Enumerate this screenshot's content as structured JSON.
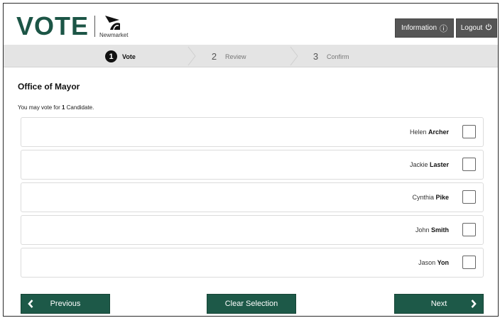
{
  "header": {
    "logo_text": "VOTE",
    "logo_subtext": "Newmarket",
    "info_label": "Information",
    "logout_label": "Logout"
  },
  "steps": [
    {
      "number": "1",
      "label": "Vote",
      "active": true
    },
    {
      "number": "2",
      "label": "Review",
      "active": false
    },
    {
      "number": "3",
      "label": "Confirm",
      "active": false
    }
  ],
  "ballot": {
    "office_title": "Office of Mayor",
    "instruction_prefix": "You may vote for ",
    "instruction_count": "1",
    "instruction_suffix": " Candidate.",
    "candidates": [
      {
        "first": "Helen",
        "last": "Archer",
        "selected": false
      },
      {
        "first": "Jackie",
        "last": "Laster",
        "selected": false
      },
      {
        "first": "Cynthia",
        "last": "Pike",
        "selected": false
      },
      {
        "first": "John",
        "last": "Smith",
        "selected": false
      },
      {
        "first": "Jason",
        "last": "Yon",
        "selected": false
      }
    ]
  },
  "footer": {
    "previous_label": "Previous",
    "clear_label": "Clear Selection",
    "next_label": "Next"
  },
  "colors": {
    "brand_green": "#1d5948",
    "header_button": "#555555",
    "steps_bar": "#e4e4e4"
  },
  "icons": {
    "info": "info-circle-icon",
    "logout": "power-icon",
    "previous": "chevron-left-icon",
    "next": "chevron-right-icon"
  }
}
